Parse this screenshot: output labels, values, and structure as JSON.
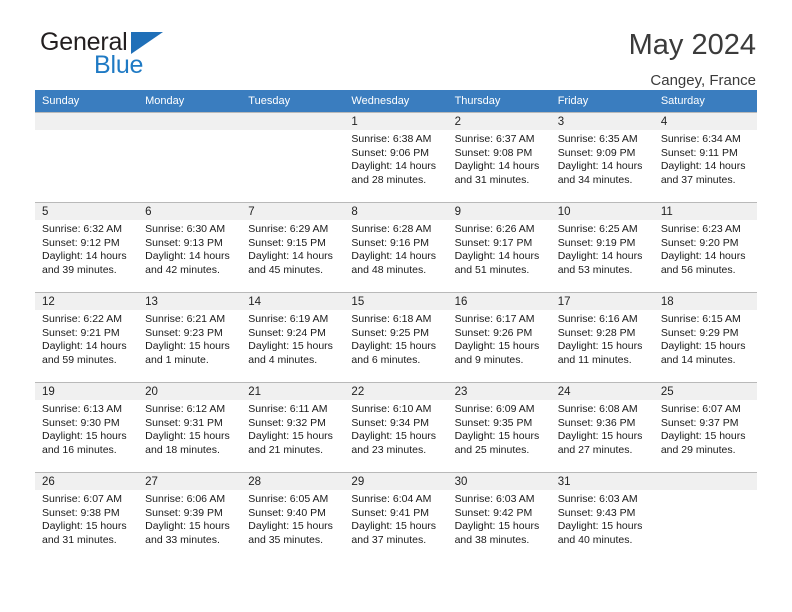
{
  "brand": {
    "name_part1": "General",
    "name_part2": "Blue",
    "triangle_icon": "triangle-icon",
    "accent_color": "#1f7ac4"
  },
  "header": {
    "title": "May 2024",
    "location": "Cangey, France",
    "header_bg": "#3a7dbf"
  },
  "weekday_headers": [
    "Sunday",
    "Monday",
    "Tuesday",
    "Wednesday",
    "Thursday",
    "Friday",
    "Saturday"
  ],
  "labels": {
    "sunrise": "Sunrise:",
    "sunset": "Sunset:",
    "daylight": "Daylight:"
  },
  "weeks": [
    [
      {
        "day": "",
        "empty": true
      },
      {
        "day": "",
        "empty": true
      },
      {
        "day": "",
        "empty": true
      },
      {
        "day": "1",
        "sunrise": "Sunrise: 6:38 AM",
        "sunset": "Sunset: 9:06 PM",
        "daylight1": "Daylight: 14 hours",
        "daylight2": "and 28 minutes."
      },
      {
        "day": "2",
        "sunrise": "Sunrise: 6:37 AM",
        "sunset": "Sunset: 9:08 PM",
        "daylight1": "Daylight: 14 hours",
        "daylight2": "and 31 minutes."
      },
      {
        "day": "3",
        "sunrise": "Sunrise: 6:35 AM",
        "sunset": "Sunset: 9:09 PM",
        "daylight1": "Daylight: 14 hours",
        "daylight2": "and 34 minutes."
      },
      {
        "day": "4",
        "sunrise": "Sunrise: 6:34 AM",
        "sunset": "Sunset: 9:11 PM",
        "daylight1": "Daylight: 14 hours",
        "daylight2": "and 37 minutes."
      }
    ],
    [
      {
        "day": "5",
        "sunrise": "Sunrise: 6:32 AM",
        "sunset": "Sunset: 9:12 PM",
        "daylight1": "Daylight: 14 hours",
        "daylight2": "and 39 minutes."
      },
      {
        "day": "6",
        "sunrise": "Sunrise: 6:30 AM",
        "sunset": "Sunset: 9:13 PM",
        "daylight1": "Daylight: 14 hours",
        "daylight2": "and 42 minutes."
      },
      {
        "day": "7",
        "sunrise": "Sunrise: 6:29 AM",
        "sunset": "Sunset: 9:15 PM",
        "daylight1": "Daylight: 14 hours",
        "daylight2": "and 45 minutes."
      },
      {
        "day": "8",
        "sunrise": "Sunrise: 6:28 AM",
        "sunset": "Sunset: 9:16 PM",
        "daylight1": "Daylight: 14 hours",
        "daylight2": "and 48 minutes."
      },
      {
        "day": "9",
        "sunrise": "Sunrise: 6:26 AM",
        "sunset": "Sunset: 9:17 PM",
        "daylight1": "Daylight: 14 hours",
        "daylight2": "and 51 minutes."
      },
      {
        "day": "10",
        "sunrise": "Sunrise: 6:25 AM",
        "sunset": "Sunset: 9:19 PM",
        "daylight1": "Daylight: 14 hours",
        "daylight2": "and 53 minutes."
      },
      {
        "day": "11",
        "sunrise": "Sunrise: 6:23 AM",
        "sunset": "Sunset: 9:20 PM",
        "daylight1": "Daylight: 14 hours",
        "daylight2": "and 56 minutes."
      }
    ],
    [
      {
        "day": "12",
        "sunrise": "Sunrise: 6:22 AM",
        "sunset": "Sunset: 9:21 PM",
        "daylight1": "Daylight: 14 hours",
        "daylight2": "and 59 minutes."
      },
      {
        "day": "13",
        "sunrise": "Sunrise: 6:21 AM",
        "sunset": "Sunset: 9:23 PM",
        "daylight1": "Daylight: 15 hours",
        "daylight2": "and 1 minute."
      },
      {
        "day": "14",
        "sunrise": "Sunrise: 6:19 AM",
        "sunset": "Sunset: 9:24 PM",
        "daylight1": "Daylight: 15 hours",
        "daylight2": "and 4 minutes."
      },
      {
        "day": "15",
        "sunrise": "Sunrise: 6:18 AM",
        "sunset": "Sunset: 9:25 PM",
        "daylight1": "Daylight: 15 hours",
        "daylight2": "and 6 minutes."
      },
      {
        "day": "16",
        "sunrise": "Sunrise: 6:17 AM",
        "sunset": "Sunset: 9:26 PM",
        "daylight1": "Daylight: 15 hours",
        "daylight2": "and 9 minutes."
      },
      {
        "day": "17",
        "sunrise": "Sunrise: 6:16 AM",
        "sunset": "Sunset: 9:28 PM",
        "daylight1": "Daylight: 15 hours",
        "daylight2": "and 11 minutes."
      },
      {
        "day": "18",
        "sunrise": "Sunrise: 6:15 AM",
        "sunset": "Sunset: 9:29 PM",
        "daylight1": "Daylight: 15 hours",
        "daylight2": "and 14 minutes."
      }
    ],
    [
      {
        "day": "19",
        "sunrise": "Sunrise: 6:13 AM",
        "sunset": "Sunset: 9:30 PM",
        "daylight1": "Daylight: 15 hours",
        "daylight2": "and 16 minutes."
      },
      {
        "day": "20",
        "sunrise": "Sunrise: 6:12 AM",
        "sunset": "Sunset: 9:31 PM",
        "daylight1": "Daylight: 15 hours",
        "daylight2": "and 18 minutes."
      },
      {
        "day": "21",
        "sunrise": "Sunrise: 6:11 AM",
        "sunset": "Sunset: 9:32 PM",
        "daylight1": "Daylight: 15 hours",
        "daylight2": "and 21 minutes."
      },
      {
        "day": "22",
        "sunrise": "Sunrise: 6:10 AM",
        "sunset": "Sunset: 9:34 PM",
        "daylight1": "Daylight: 15 hours",
        "daylight2": "and 23 minutes."
      },
      {
        "day": "23",
        "sunrise": "Sunrise: 6:09 AM",
        "sunset": "Sunset: 9:35 PM",
        "daylight1": "Daylight: 15 hours",
        "daylight2": "and 25 minutes."
      },
      {
        "day": "24",
        "sunrise": "Sunrise: 6:08 AM",
        "sunset": "Sunset: 9:36 PM",
        "daylight1": "Daylight: 15 hours",
        "daylight2": "and 27 minutes."
      },
      {
        "day": "25",
        "sunrise": "Sunrise: 6:07 AM",
        "sunset": "Sunset: 9:37 PM",
        "daylight1": "Daylight: 15 hours",
        "daylight2": "and 29 minutes."
      }
    ],
    [
      {
        "day": "26",
        "sunrise": "Sunrise: 6:07 AM",
        "sunset": "Sunset: 9:38 PM",
        "daylight1": "Daylight: 15 hours",
        "daylight2": "and 31 minutes."
      },
      {
        "day": "27",
        "sunrise": "Sunrise: 6:06 AM",
        "sunset": "Sunset: 9:39 PM",
        "daylight1": "Daylight: 15 hours",
        "daylight2": "and 33 minutes."
      },
      {
        "day": "28",
        "sunrise": "Sunrise: 6:05 AM",
        "sunset": "Sunset: 9:40 PM",
        "daylight1": "Daylight: 15 hours",
        "daylight2": "and 35 minutes."
      },
      {
        "day": "29",
        "sunrise": "Sunrise: 6:04 AM",
        "sunset": "Sunset: 9:41 PM",
        "daylight1": "Daylight: 15 hours",
        "daylight2": "and 37 minutes."
      },
      {
        "day": "30",
        "sunrise": "Sunrise: 6:03 AM",
        "sunset": "Sunset: 9:42 PM",
        "daylight1": "Daylight: 15 hours",
        "daylight2": "and 38 minutes."
      },
      {
        "day": "31",
        "sunrise": "Sunrise: 6:03 AM",
        "sunset": "Sunset: 9:43 PM",
        "daylight1": "Daylight: 15 hours",
        "daylight2": "and 40 minutes."
      },
      {
        "day": "",
        "empty": true
      }
    ]
  ]
}
